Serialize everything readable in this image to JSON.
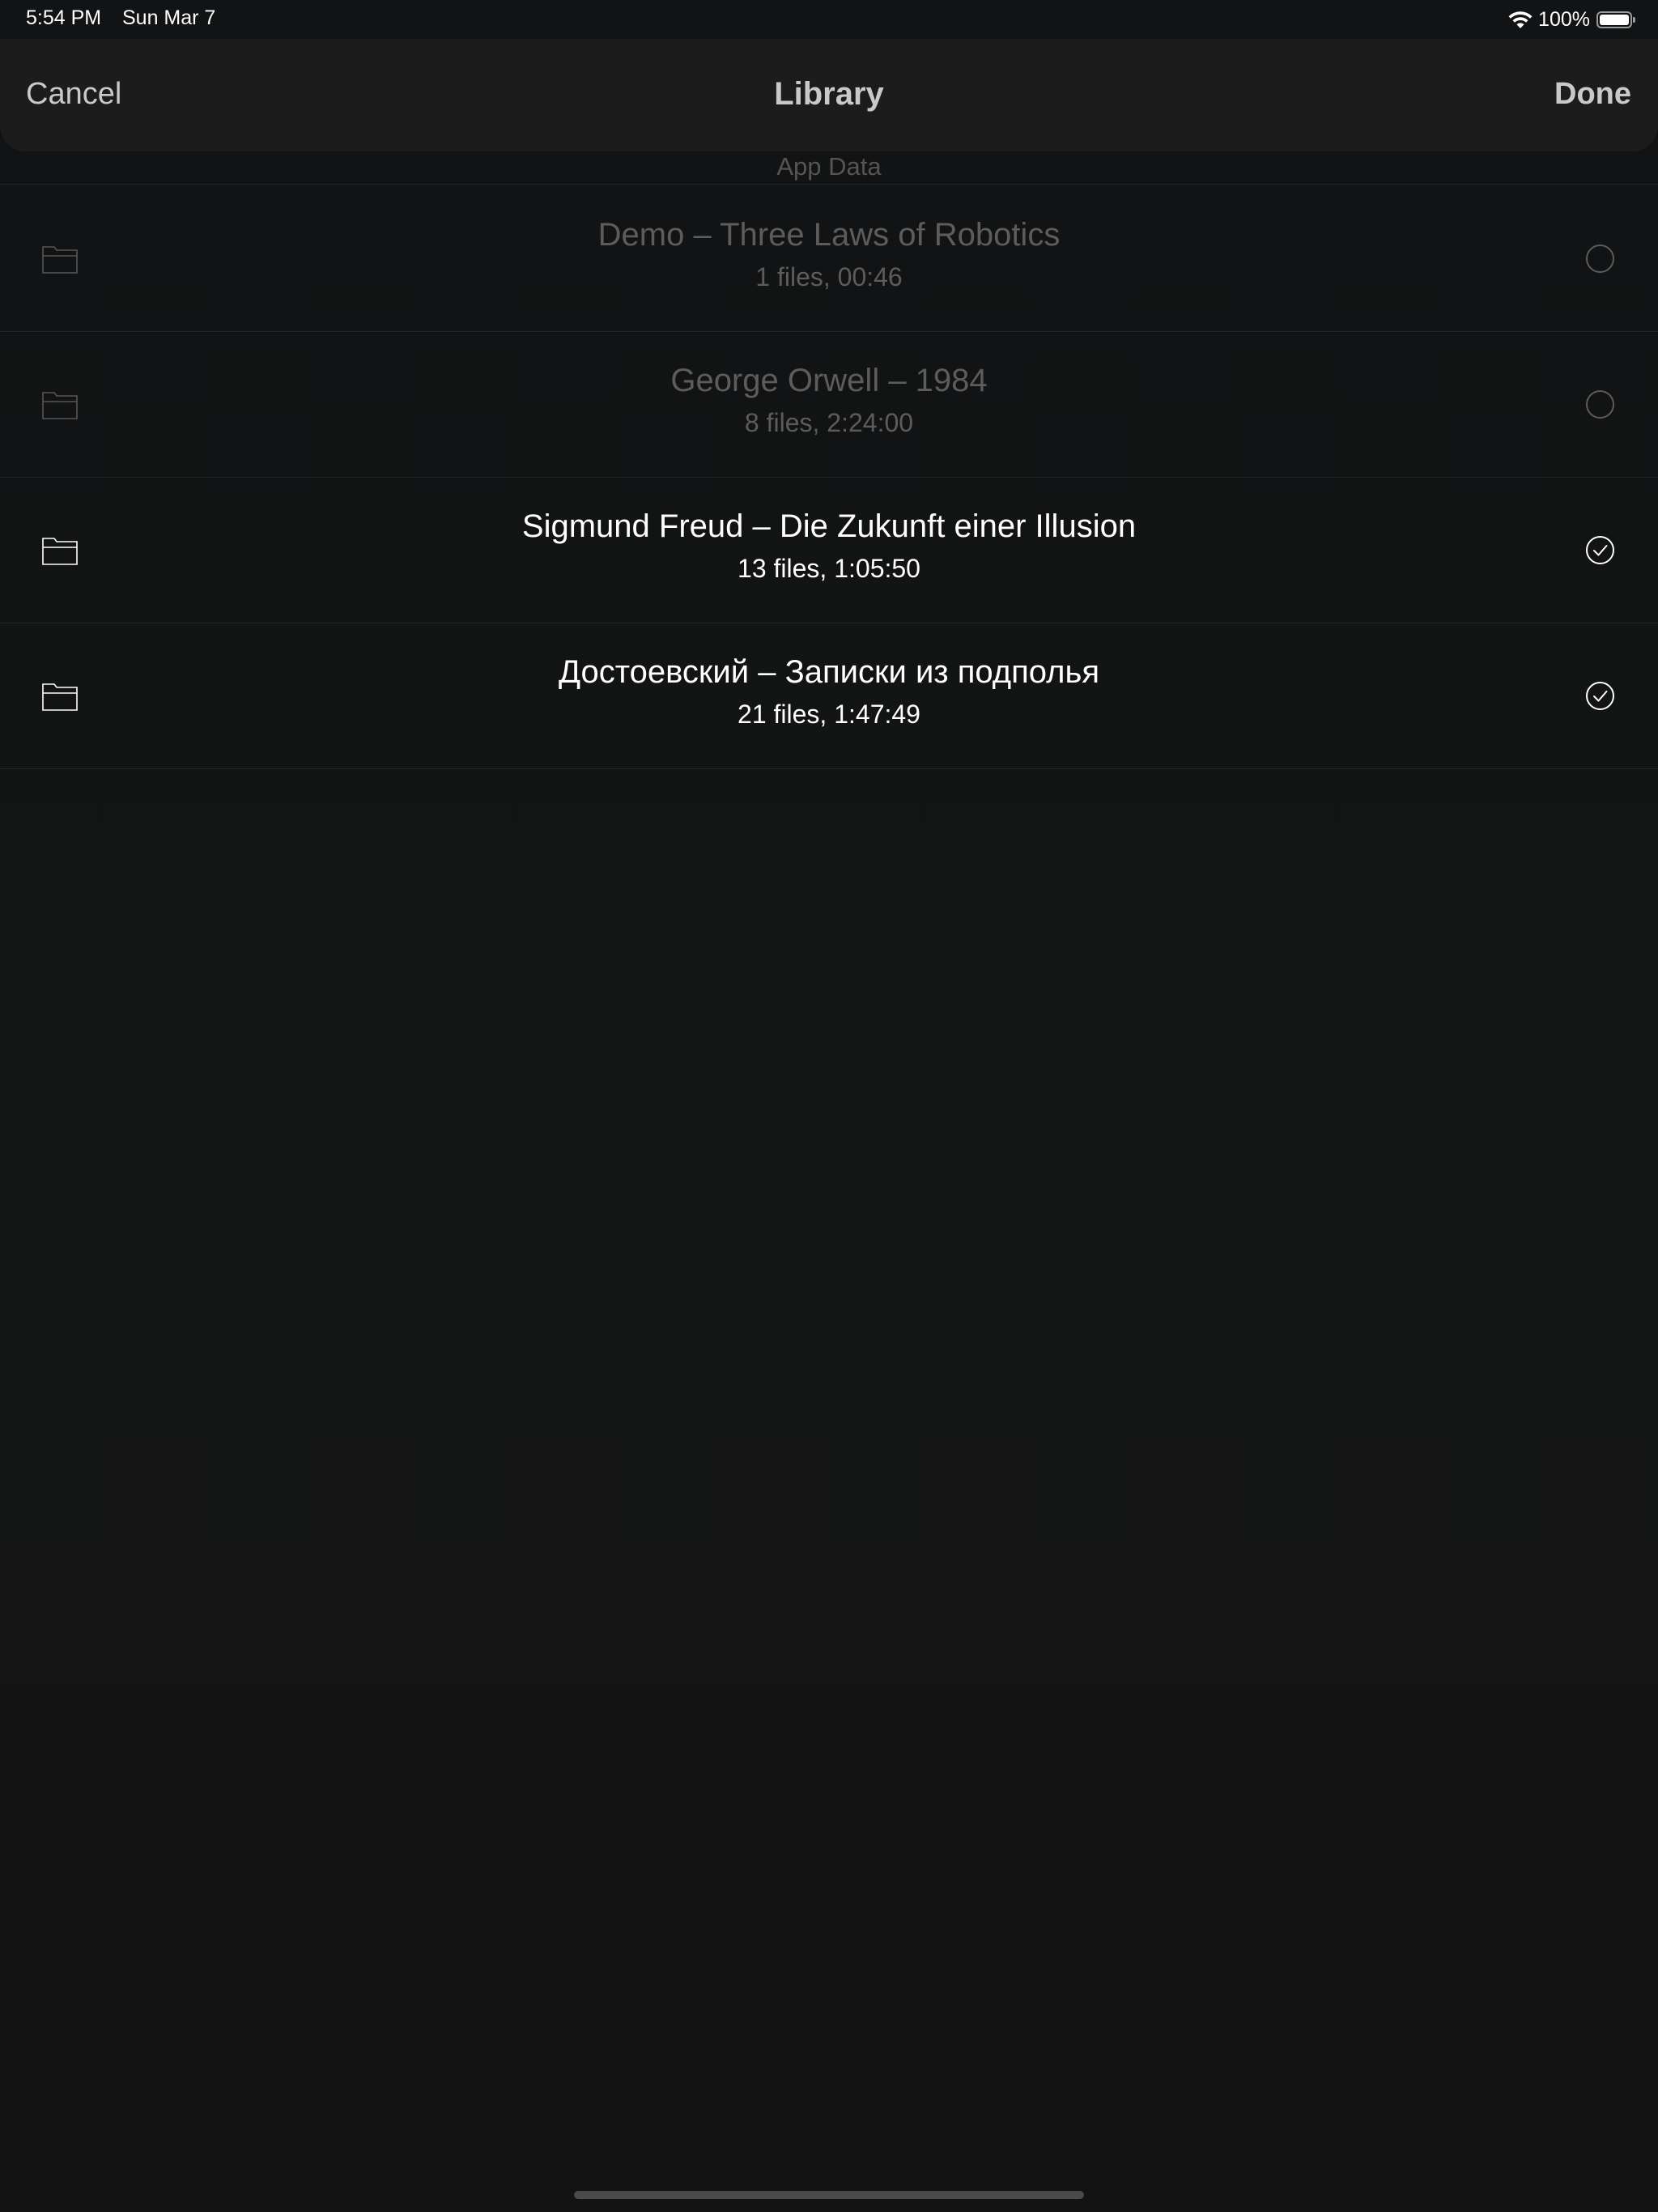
{
  "status_bar": {
    "time": "5:54 PM",
    "date": "Sun Mar 7",
    "battery_percent": "100%",
    "battery_level": 1.0
  },
  "nav": {
    "cancel_label": "Cancel",
    "title": "Library",
    "done_label": "Done"
  },
  "section": {
    "header": "App Data"
  },
  "items": [
    {
      "title": "Demo – Three Laws of Robotics",
      "subtitle": "1 files, 00:46",
      "selected": false
    },
    {
      "title": "George Orwell – 1984",
      "subtitle": "8 files, 2:24:00",
      "selected": false
    },
    {
      "title": "Sigmund Freud – Die Zukunft einer Illusion",
      "subtitle": "13 files, 1:05:50",
      "selected": true
    },
    {
      "title": "Достоевский – Записки из подполья",
      "subtitle": "21 files, 1:47:49",
      "selected": true
    }
  ],
  "colors": {
    "background": "#131313",
    "nav_background": "#1c1c1c",
    "nav_text": "#c9c9c9",
    "dim_text": "#5c5c5c",
    "active_text": "#ffffff"
  }
}
